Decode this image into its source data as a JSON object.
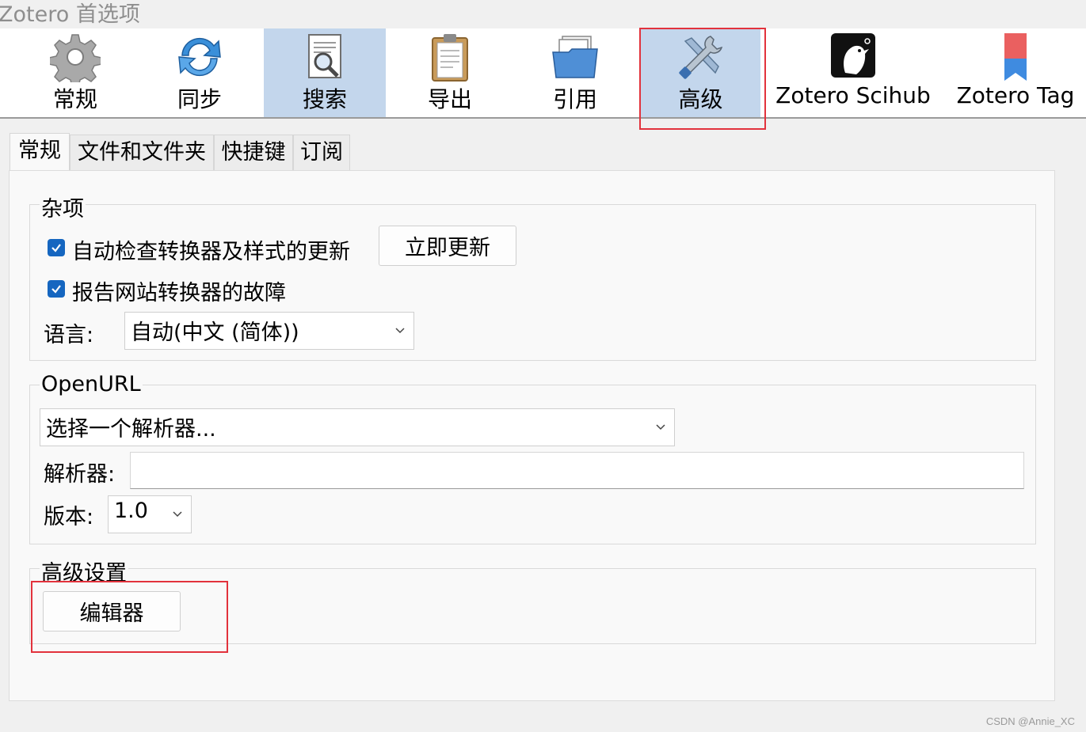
{
  "window": {
    "title": "Zotero 首选项"
  },
  "toolbar": {
    "items": [
      {
        "label": "常规",
        "icon": "gear-icon"
      },
      {
        "label": "同步",
        "icon": "sync-icon"
      },
      {
        "label": "搜索",
        "icon": "search-document-icon"
      },
      {
        "label": "导出",
        "icon": "clipboard-icon"
      },
      {
        "label": "引用",
        "icon": "folder-documents-icon"
      },
      {
        "label": "高级",
        "icon": "tools-icon"
      },
      {
        "label": "Zotero Scihub",
        "icon": "scihub-raven-icon"
      },
      {
        "label": "Zotero Tag",
        "icon": "bookmark-tag-icon"
      }
    ],
    "selected": "搜索",
    "highlighted": "高级"
  },
  "subtabs": [
    "常规",
    "文件和文件夹",
    "快捷键",
    "订阅"
  ],
  "misc": {
    "legend": "杂项",
    "auto_check_label": "自动检查转换器及样式的更新",
    "auto_check_checked": true,
    "update_now_button": "立即更新",
    "report_label": "报告网站转换器的故障",
    "report_checked": true,
    "language_label": "语言:",
    "language_value": "自动(中文 (简体))"
  },
  "openurl": {
    "legend": "OpenURL",
    "resolver_select_value": "选择一个解析器...",
    "resolver_label": "解析器:",
    "resolver_value": "",
    "version_label": "版本:",
    "version_value": "1.0"
  },
  "advanced": {
    "legend": "高级设置",
    "editor_button": "编辑器"
  },
  "watermark": "CSDN @Annie_XC",
  "colors": {
    "accent": "#1566c0",
    "selected_tab_bg": "#c3d6ec",
    "highlight_box": "#e2323c"
  }
}
